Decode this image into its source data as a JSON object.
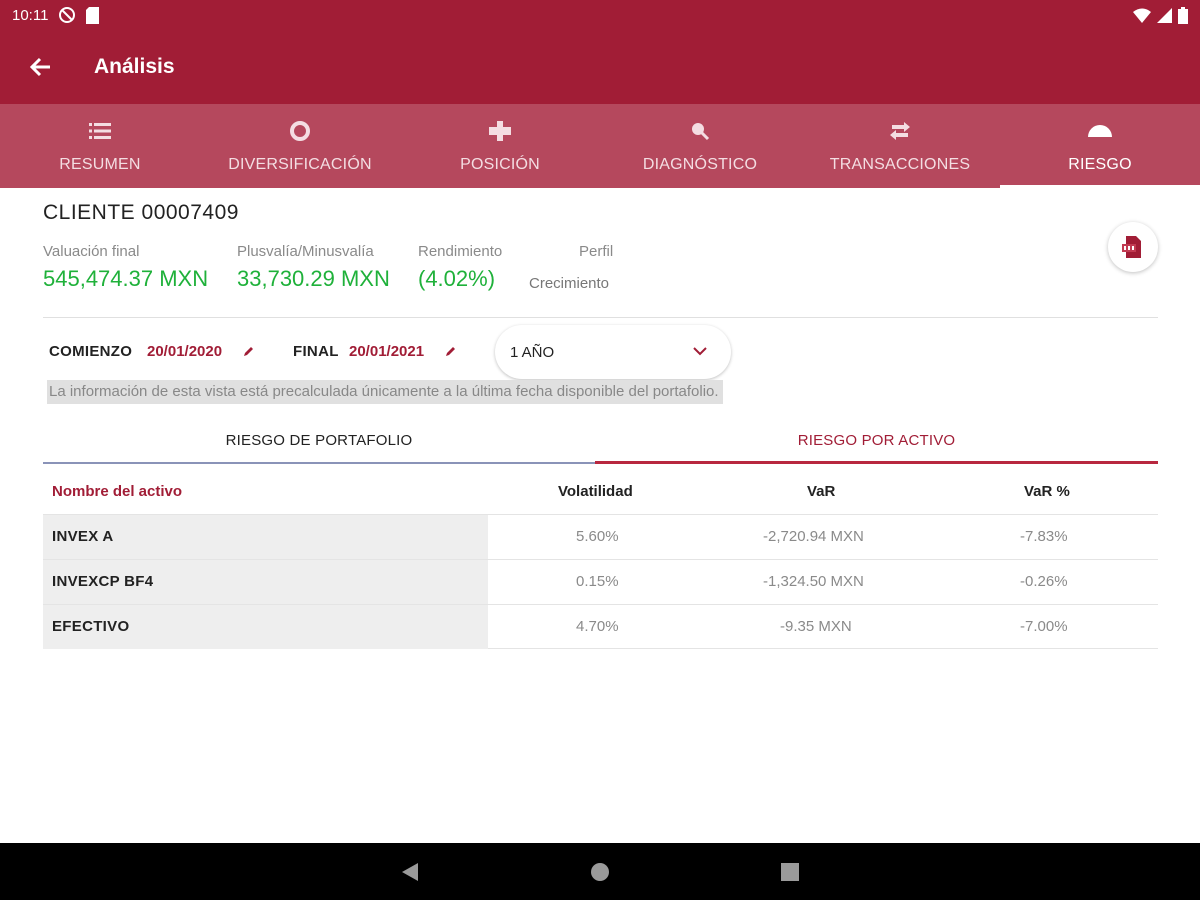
{
  "status": {
    "time": "10:11"
  },
  "appbar": {
    "title": "Análisis"
  },
  "tabs": [
    {
      "label": "RESUMEN",
      "icon": "list-icon"
    },
    {
      "label": "DIVERSIFICACIÓN",
      "icon": "donut-icon"
    },
    {
      "label": "POSICIÓN",
      "icon": "position-icon"
    },
    {
      "label": "DIAGNÓSTICO",
      "icon": "diagnostic-icon"
    },
    {
      "label": "TRANSACCIONES",
      "icon": "swap-icon"
    },
    {
      "label": "RIESGO",
      "icon": "gauge-icon",
      "active": true
    }
  ],
  "client": {
    "title": "CLIENTE 00007409",
    "metrics": [
      {
        "label": "Valuación final",
        "value": "545,474.37 MXN"
      },
      {
        "label": "Plusvalía/Minusvalía",
        "value": "33,730.29 MXN"
      },
      {
        "label": "Rendimiento",
        "value": "(4.02%)"
      }
    ],
    "perfil": {
      "label": "Perfil",
      "value": "Crecimiento"
    }
  },
  "dates": {
    "start_label": "COMIENZO",
    "start_value": "20/01/2020",
    "end_label": "FINAL",
    "end_value": "20/01/2021",
    "period": "1 AÑO"
  },
  "notice": "La información de esta vista está precalculada únicamente a la última fecha disponible del portafolio.",
  "subtabs": {
    "left": "RIESGO DE PORTAFOLIO",
    "right": "RIESGO POR ACTIVO"
  },
  "table": {
    "headers": [
      "Nombre del activo",
      "Volatilidad",
      "VaR",
      "VaR %"
    ],
    "rows": [
      {
        "name": "INVEX A",
        "volatilidad": "5.60%",
        "var": "-2,720.94 MXN",
        "var_pct": "-7.83%"
      },
      {
        "name": "INVEXCP BF4",
        "volatilidad": "0.15%",
        "var": "-1,324.50 MXN",
        "var_pct": "-0.26%"
      },
      {
        "name": "EFECTIVO",
        "volatilidad": "4.70%",
        "var": "-9.35 MXN",
        "var_pct": "-7.00%"
      }
    ]
  },
  "colors": {
    "primary": "#a11d36",
    "tabbar": "#b5485d",
    "positive": "#1fb13a"
  }
}
